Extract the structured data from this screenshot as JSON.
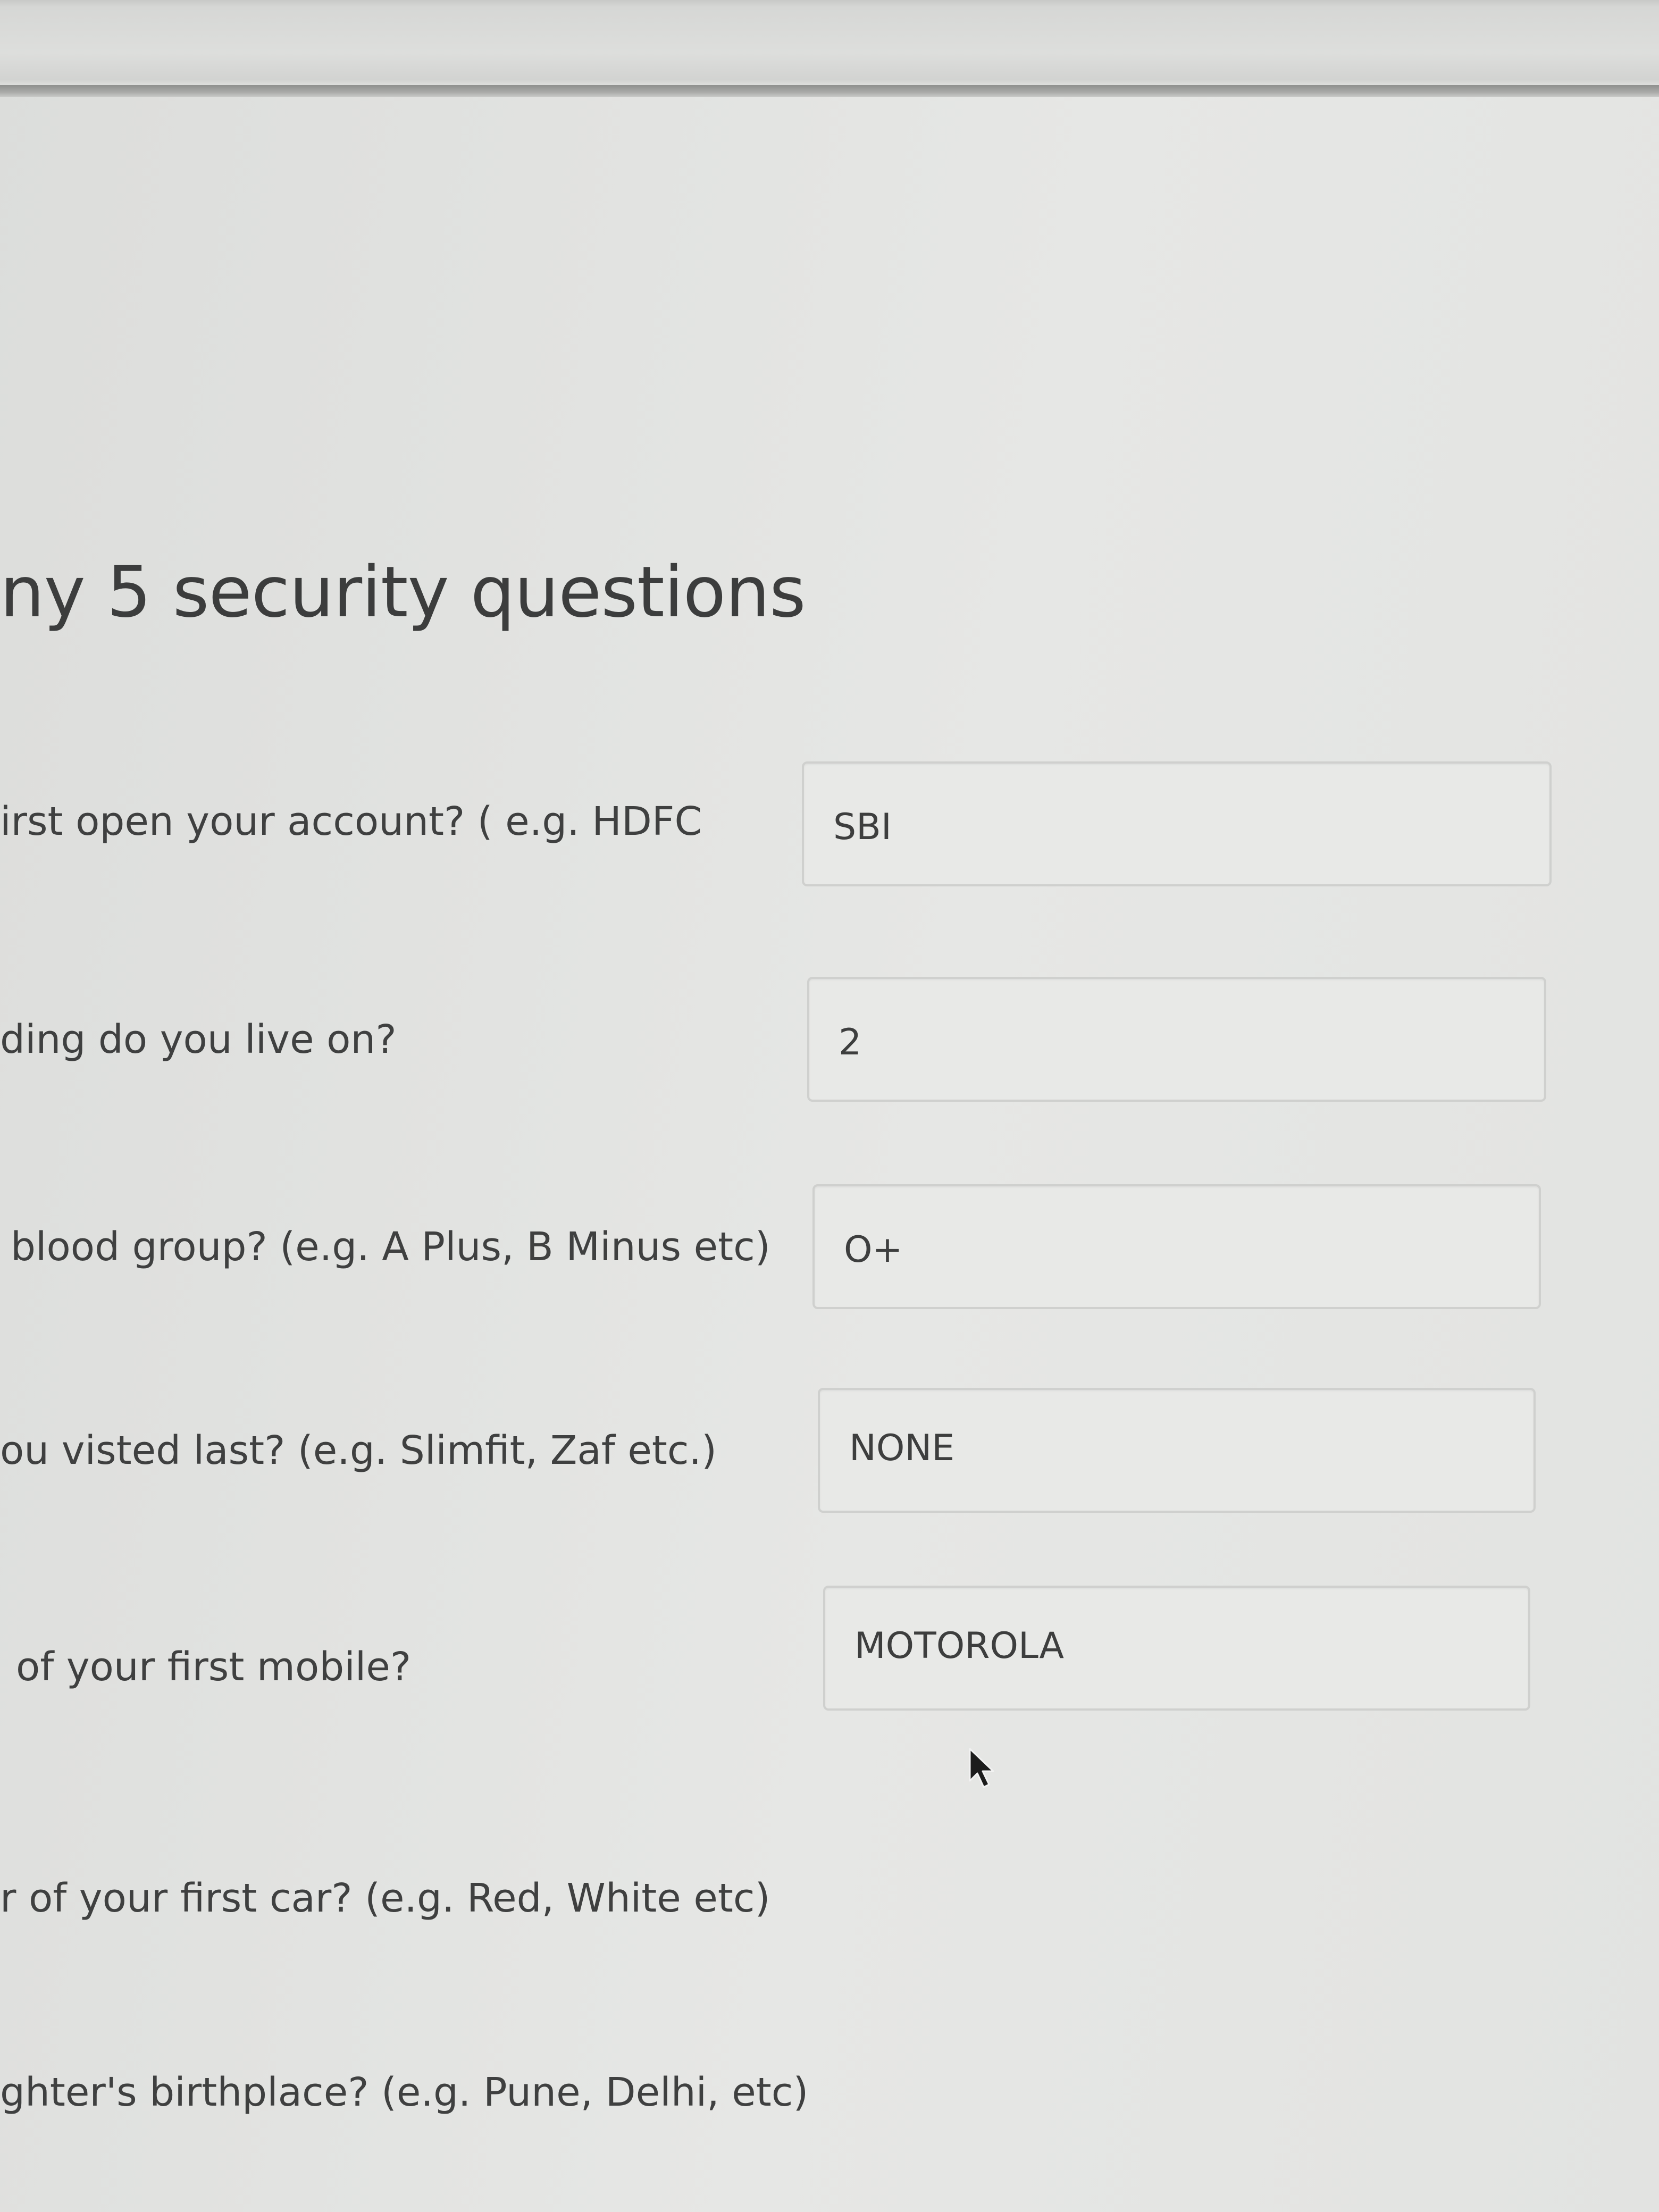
{
  "section": {
    "heading": "ny 5 security questions"
  },
  "questions": [
    {
      "label": "irst open your account? ( e.g. HDFC",
      "value": "SBI"
    },
    {
      "label": "ding do you live on?",
      "value": "2"
    },
    {
      "label": "blood group? (e.g. A Plus, B Minus etc)",
      "value": "O+"
    },
    {
      "label": "ou visted last? (e.g. Slimfit, Zaf etc.)",
      "value": "NONE"
    },
    {
      "label": "of your first mobile?",
      "value": "MOTOROLA"
    },
    {
      "label": "r of your first car? (e.g. Red, White etc)"
    },
    {
      "label": "ghter's birthplace? (e.g. Pune, Delhi, etc)"
    }
  ],
  "icons": {
    "cursor": "mouse-pointer-icon"
  }
}
